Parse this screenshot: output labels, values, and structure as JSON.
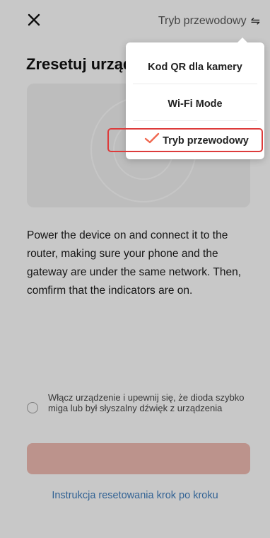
{
  "header": {
    "mode_label": "Tryb przewodowy",
    "close_icon": "close-icon",
    "swap_icon": "swap-arrows-icon"
  },
  "title": "Zresetuj urząd",
  "description": "Power the device on and connect it to the router, making sure your phone and the gateway are under the same network. Then, comfirm that the indicators are on.",
  "confirm": {
    "checked": false,
    "text": "Włącz urządzenie i upewnij się, że dioda szybko miga lub był słyszalny dźwięk z urządzenia"
  },
  "reset_link": "Instrukcja resetowania krok po kroku",
  "dropdown": {
    "items": [
      {
        "label": "Kod QR dla kamery",
        "selected": false
      },
      {
        "label": "Wi-Fi Mode",
        "selected": false
      },
      {
        "label": "Tryb przewodowy",
        "selected": true
      }
    ],
    "check_icon": "checkmark-icon"
  },
  "colors": {
    "accent": "#f0674f",
    "button_disabled": "#e6b4ab",
    "link": "#3c78b5",
    "highlight_border": "#dd3b3b"
  }
}
